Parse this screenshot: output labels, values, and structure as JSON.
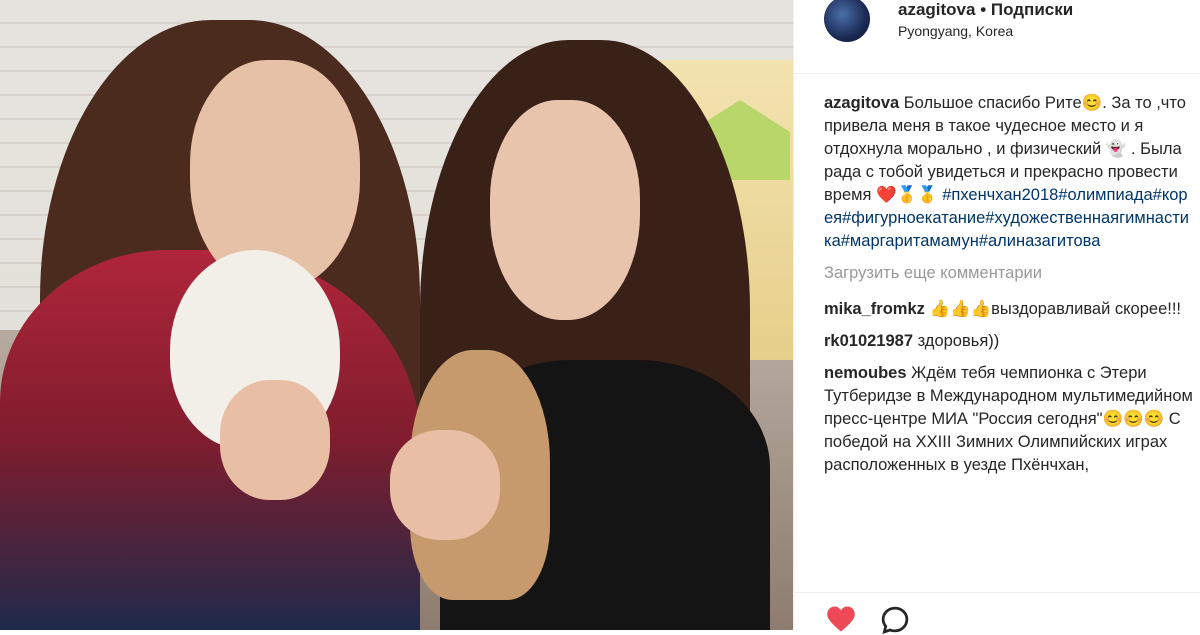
{
  "post": {
    "username": "azagitova",
    "separator": " • ",
    "follow_label": "Подписки",
    "location": "Pyongyang, Korea"
  },
  "caption": {
    "username": "azagitova",
    "text": "Большое спасибо Рите😊. За то ,что привела меня в такое чудесное место и я отдохнула морально , и физический 👻 . Была рада с тобой увидеться и прекрасно провести время ❤️🥇🥇",
    "hashtags": "#пхенчхан2018#олимпиада#корея#фигурноекатание#художественнаягимнастика#маргаритамамун#алиназагитова"
  },
  "load_more_label": "Загрузить еще комментарии",
  "comments": [
    {
      "username": "mika_fromkz",
      "text": "👍👍👍выздоравливай скорее!!!"
    },
    {
      "username": "rk01021987",
      "text": "здоровья))"
    },
    {
      "username": "nemoubes",
      "text": "Ждём тебя чемпионка с Этери Тутберидзе в Международном мультимедийном пресс-центре МИА \"Россия сегодня\"😊😊😊 С победой на XXIII Зимних Олимпийских играх расположенных в уезде Пхёнчхан,"
    }
  ],
  "icons": {
    "like": "heart-icon",
    "comment": "comment-icon",
    "like_color": "#ed4956"
  }
}
